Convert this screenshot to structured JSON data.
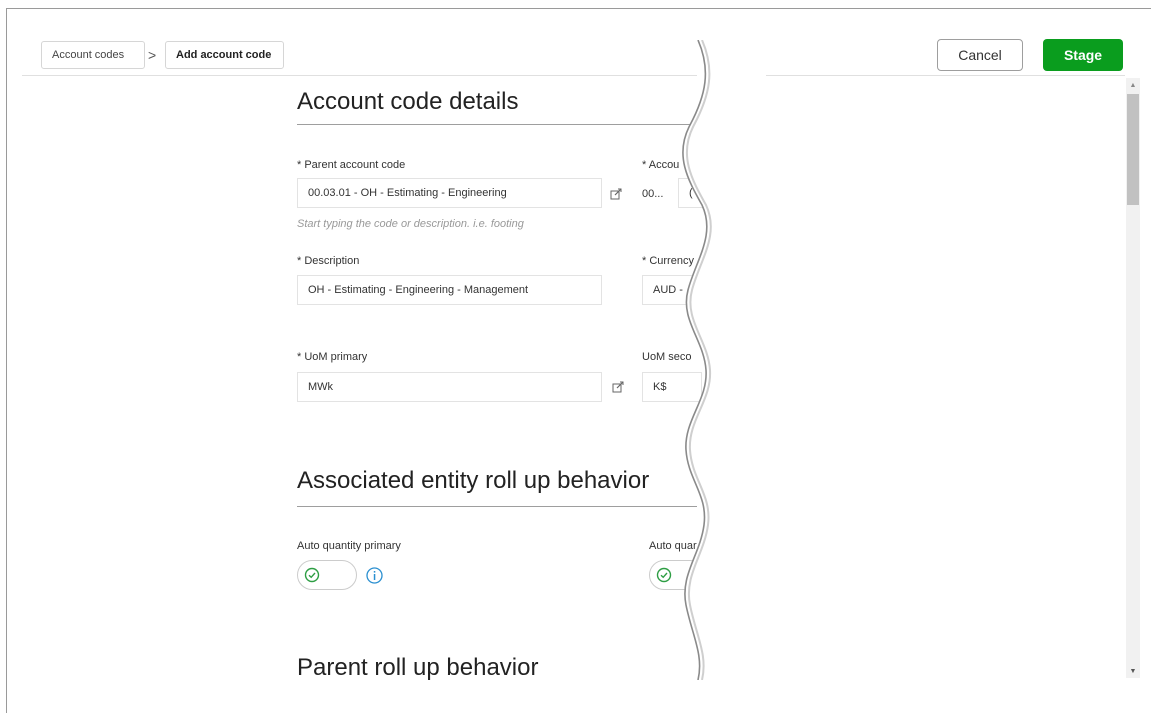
{
  "breadcrumb": {
    "items": [
      "Account codes",
      "Add account code"
    ],
    "separator": ">"
  },
  "header": {
    "cancel_label": "Cancel",
    "stage_label": "Stage"
  },
  "colors": {
    "stage_button": "#0a9d1e",
    "toggle_check": "#2e9e44",
    "info_icon": "#2a8fd0"
  },
  "sections": {
    "details_title": "Account code details",
    "rollup_title": "Associated entity roll up behavior",
    "parent_title": "Parent roll up behavior"
  },
  "fields": {
    "parent_label": "* Parent account code",
    "parent_value": "00.03.01 - OH - Estimating - Engineering",
    "parent_hint": "Start typing the code or description. i.e. footing",
    "account_label": "* Accou",
    "account_value_prefix": "00...",
    "account_value": "(",
    "description_label": "* Description",
    "description_value": "OH - Estimating - Engineering - Management",
    "currency_label": "* Currency",
    "currency_value": "AUD -",
    "uom_primary_label": "* UoM primary",
    "uom_primary_value": "MWk",
    "uom_secondary_label": "UoM seco",
    "uom_secondary_value": "K$"
  },
  "rollup": {
    "auto_qty_primary_label": "Auto quantity primary",
    "auto_qty_secondary_label": "Auto quar",
    "auto_qty_primary_on": true,
    "auto_qty_secondary_on": true
  },
  "icons": {
    "edit": "edit-icon",
    "info": "info-icon",
    "check": "check-circle-icon",
    "chevron": "chevron-right-icon"
  }
}
